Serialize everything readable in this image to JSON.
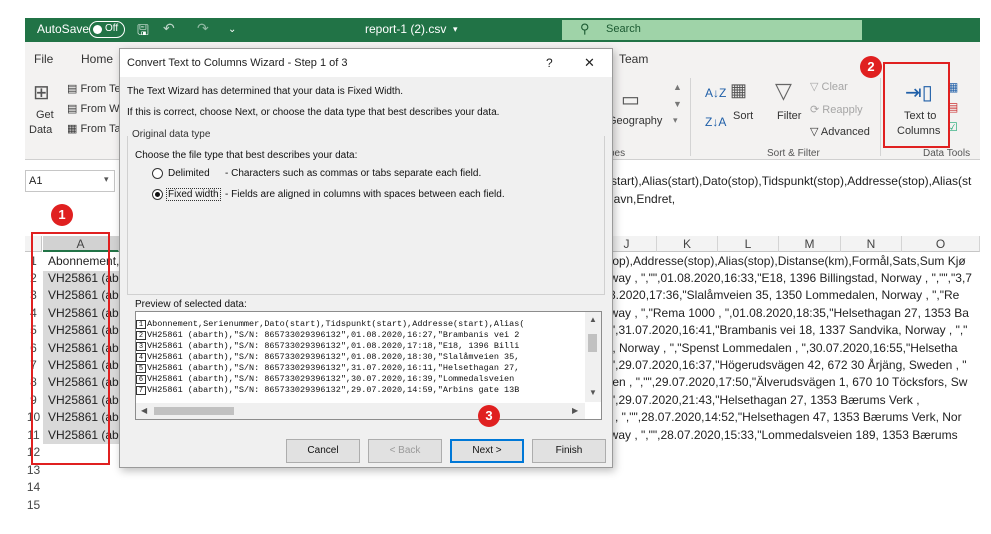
{
  "titlebar": {
    "autosave": "AutoSave",
    "toggle": "Off",
    "filename": "report-1 (2).csv",
    "search_placeholder": "Search"
  },
  "ribbon": {
    "file_tab": "File",
    "home_tab": "Home",
    "team_tab": "Team",
    "get_data": "Get",
    "get_data2": "Data",
    "from_text": "From Te",
    "from_web": "From W",
    "from_table": "From Ta",
    "geography": "Geography",
    "sort": "Sort",
    "filter": "Filter",
    "clear": "Clear",
    "reapply": "Reapply",
    "advanced": "Advanced",
    "text_to": "Text to",
    "columns": "Columns",
    "sort_filter_group": "Sort & Filter",
    "data_tools_group": "Data Tools",
    "types_group": "pes"
  },
  "formula": {
    "name_box": "A1",
    "line1": "(start),Alias(start),Dato(stop),Tidspunkt(stop),Addresse(stop),Alias(st",
    "line2": "navn,Endret,"
  },
  "grid": {
    "col_a": "A",
    "right_cols": [
      "J",
      "K",
      "L",
      "M",
      "N",
      "O"
    ],
    "row_numbers": [
      "1",
      "2",
      "3",
      "4",
      "5",
      "6",
      "7",
      "8",
      "9",
      "10",
      "11",
      "12",
      "13",
      "14",
      "15"
    ],
    "col_a_cells": [
      "Abonnement,",
      "VH25861 (ab",
      "VH25861 (ab",
      "VH25861 (ab",
      "VH25861 (ab",
      "VH25861 (ab",
      "VH25861 (ab",
      "VH25861 (ab",
      "VH25861 (ab",
      "VH25861 (ab",
      "VH25861 (ab"
    ],
    "right_cells": [
      "(stop),Addresse(stop),Alias(stop),Distanse(km),Formål,Sats,Sum Kjø",
      "orway , \",\"\",01.08.2020,16:33,\"E18, 1396 Billingstad, Norway , \",\"\",\"3,7",
      ".08.2020,17:36,\"Slalåmveien 35, 1350 Lommedalen, Norway , \",\"Re",
      "orway , \",\"Rema 1000 , \",01.08.2020,18:35,\"Helsethagan 27, 1353 Ba",
      "\",\"\",31.07.2020,16:41,\"Brambanis vei 18, 1337 Sandvika, Norway , \",\"",
      "en, Norway , \",\"Spenst Lommedalen , \",30.07.2020,16:55,\"Helsetha",
      "\",\"\",29.07.2020,16:37,\"Högerudsvägen 42, 672 30 Årjäng, Sweden , \"",
      "eden , \",\"\",29.07.2020,17:50,\"Älverudsvägen 1, 670 10 Töcksfors, Sw",
      "\",\"\",29.07.2020,21:43,\"Helsethagan 27, 1353 Bærums Verk , ",
      "ay , \",\"\",28.07.2020,14:52,\"Helsethagen 47, 1353 Bærums Verk, Nor",
      "orway , \",\"\",28.07.2020,15:33,\"Lommedalsveien 189, 1353 Bærums"
    ]
  },
  "dialog": {
    "title": "Convert Text to Columns Wizard - Step 1 of 3",
    "help": "?",
    "close": "✕",
    "line1": "The Text Wizard has determined that your data is Fixed Width.",
    "line2": "If this is correct, choose Next, or choose the data type that best describes your data.",
    "section": "Original data type",
    "choose": "Choose the file type that best describes your data:",
    "delimited_label": "Delimited",
    "delimited_desc": "- Characters such as commas or tabs separate each field.",
    "fixed_label": "Fixed width",
    "fixed_desc": "- Fields are aligned in columns with spaces between each field.",
    "preview_label": "Preview of selected data:",
    "preview_lines": [
      "Abonnement,Serienummer,Dato(start),Tidspunkt(start),Addresse(start),Alias(",
      "VH25861 (abarth),\"S/N: 865733029396132\",01.08.2020,16:27,\"Brambanis vei 2",
      "VH25861 (abarth),\"S/N: 865733029396132\",01.08.2020,17:18,\"E18, 1396 Billi",
      "VH25861 (abarth),\"S/N: 865733029396132\",01.08.2020,18:30,\"Slalåmveien 35,",
      "VH25861 (abarth),\"S/N: 865733029396132\",31.07.2020,16:11,\"Helsethagan 27,",
      "VH25861 (abarth),\"S/N: 865733029396132\",30.07.2020,16:39,\"Lommedalsveien",
      "VH25861 (abarth),\"S/N: 865733029396132\",29.07.2020,14:59,\"Arbins gate 13B"
    ],
    "preview_nums": [
      "1",
      "2",
      "3",
      "4",
      "5",
      "6",
      "7"
    ],
    "cancel": "Cancel",
    "back": "< Back",
    "next": "Next >",
    "finish": "Finish"
  },
  "annotations": {
    "b1": "1",
    "b2": "2",
    "b3": "3",
    "color": "#e02020"
  }
}
